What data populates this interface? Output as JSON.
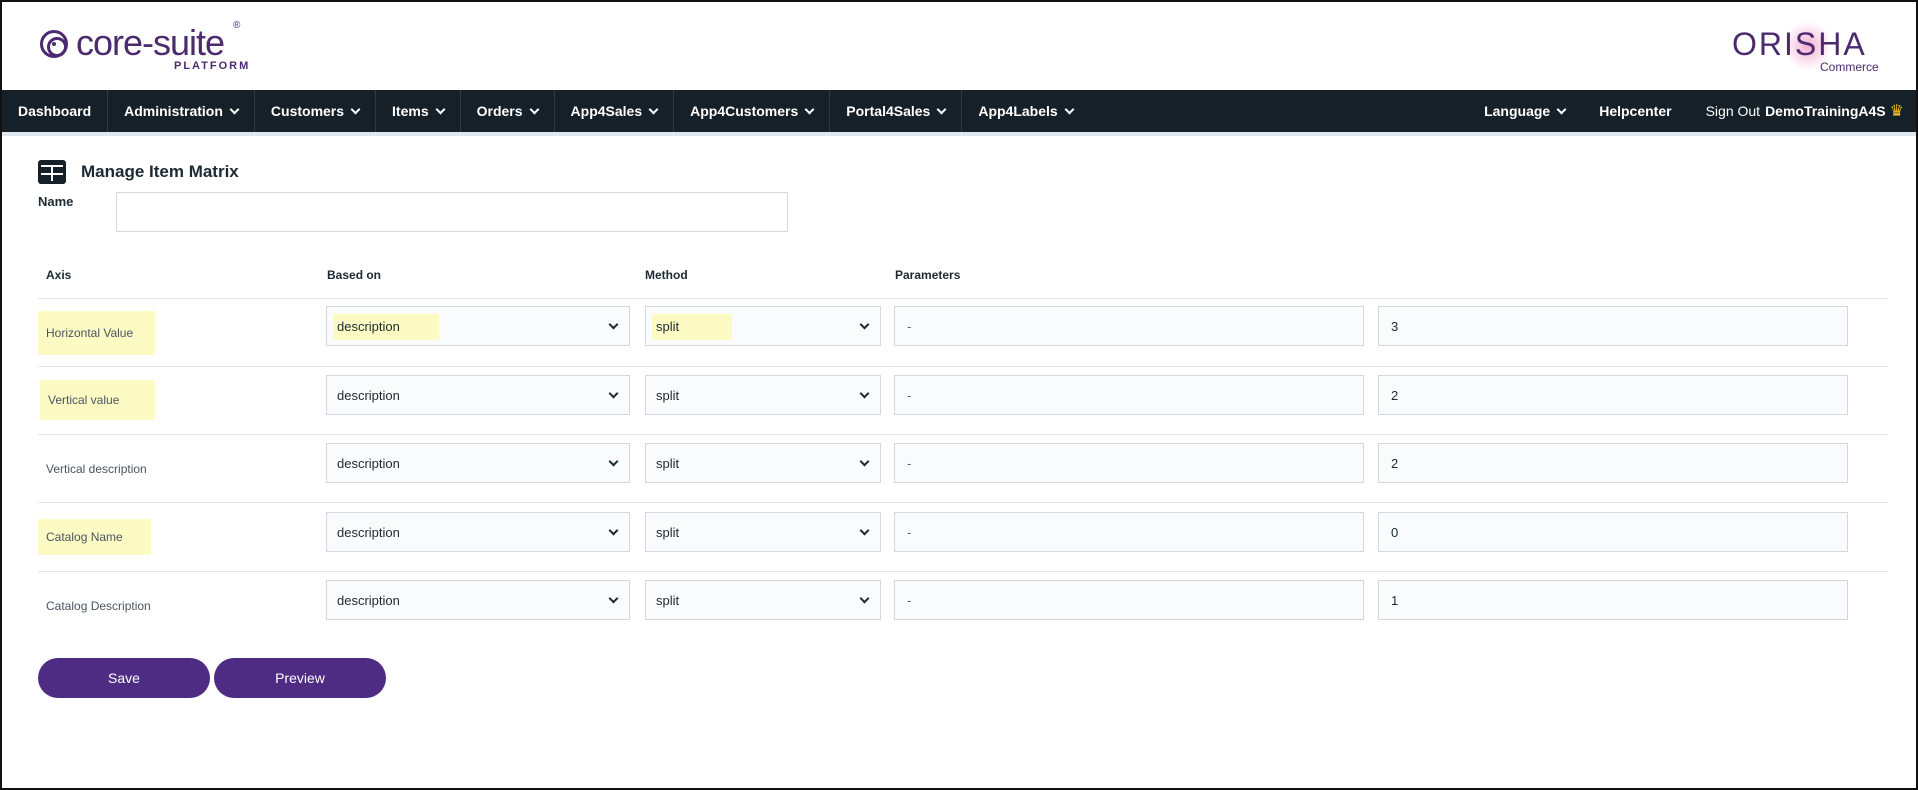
{
  "header": {
    "logo_text": "core-suite",
    "logo_reg": "®",
    "logo_sub": "PLATFORM",
    "brand_name": "ORISHA",
    "brand_sub": "Commerce"
  },
  "nav": {
    "items": [
      {
        "label": "Dashboard",
        "dropdown": false
      },
      {
        "label": "Administration",
        "dropdown": true
      },
      {
        "label": "Customers",
        "dropdown": true
      },
      {
        "label": "Items",
        "dropdown": true
      },
      {
        "label": "Orders",
        "dropdown": true
      },
      {
        "label": "App4Sales",
        "dropdown": true
      },
      {
        "label": "App4Customers",
        "dropdown": true
      },
      {
        "label": "Portal4Sales",
        "dropdown": true
      },
      {
        "label": "App4Labels",
        "dropdown": true
      }
    ],
    "language": "Language",
    "helpcenter": "Helpcenter",
    "sign_out": "Sign Out",
    "user": "DemoTrainingA4S"
  },
  "page": {
    "title": "Manage Item Matrix",
    "name_label": "Name",
    "name_value": ""
  },
  "table": {
    "headers": {
      "axis": "Axis",
      "based_on": "Based on",
      "method": "Method",
      "parameters": "Parameters"
    },
    "rows": [
      {
        "axis": "Horizontal Value",
        "based_on": "description",
        "method": "split",
        "param1": "-",
        "param2": "3"
      },
      {
        "axis": "Vertical value",
        "based_on": "description",
        "method": "split",
        "param1": "-",
        "param2": "2"
      },
      {
        "axis": "Vertical description",
        "based_on": "description",
        "method": "split",
        "param1": "-",
        "param2": "2"
      },
      {
        "axis": "Catalog Name",
        "based_on": "description",
        "method": "split",
        "param1": "-",
        "param2": "0"
      },
      {
        "axis": "Catalog Description",
        "based_on": "description",
        "method": "split",
        "param1": "-",
        "param2": "1"
      }
    ]
  },
  "actions": {
    "save": "Save",
    "preview": "Preview"
  },
  "colors": {
    "brand_purple": "#4b2a6e",
    "button_purple": "#4e2c83",
    "nav_bg": "#152028",
    "highlight": "#fdfbc4"
  }
}
